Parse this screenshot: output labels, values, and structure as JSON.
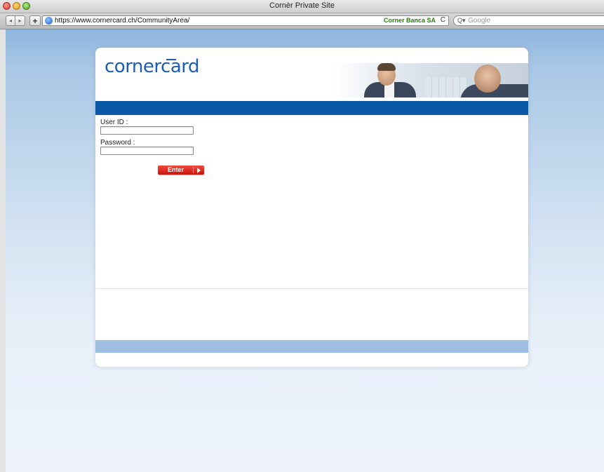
{
  "window": {
    "title": "Cornèr Private Site"
  },
  "toolbar": {
    "back_glyph": "◂",
    "forward_glyph": "▸",
    "add_glyph": "+",
    "url": "https://www.cornercard.ch/CommunityArea/",
    "site_identity": "Corner Banca SA",
    "reload_glyph": "C",
    "search_glyph": "Q▾",
    "search_placeholder": "Google"
  },
  "page": {
    "logo_text": "cornercard",
    "form": {
      "userid_label": "User ID :",
      "userid_value": "",
      "password_label": "Password :",
      "password_value": "",
      "enter_label": "Enter"
    }
  },
  "colors": {
    "brand_blue": "#0a58a6",
    "logo_blue": "#1d5db8",
    "enter_red": "#d8241a",
    "footer_band": "#9fbfe0",
    "site_identity_green": "#2a7b12"
  },
  "icons": {
    "lock": "lock-icon",
    "reload": "reload-icon",
    "search": "search-icon",
    "enter_arrow": "arrow-right-icon"
  }
}
